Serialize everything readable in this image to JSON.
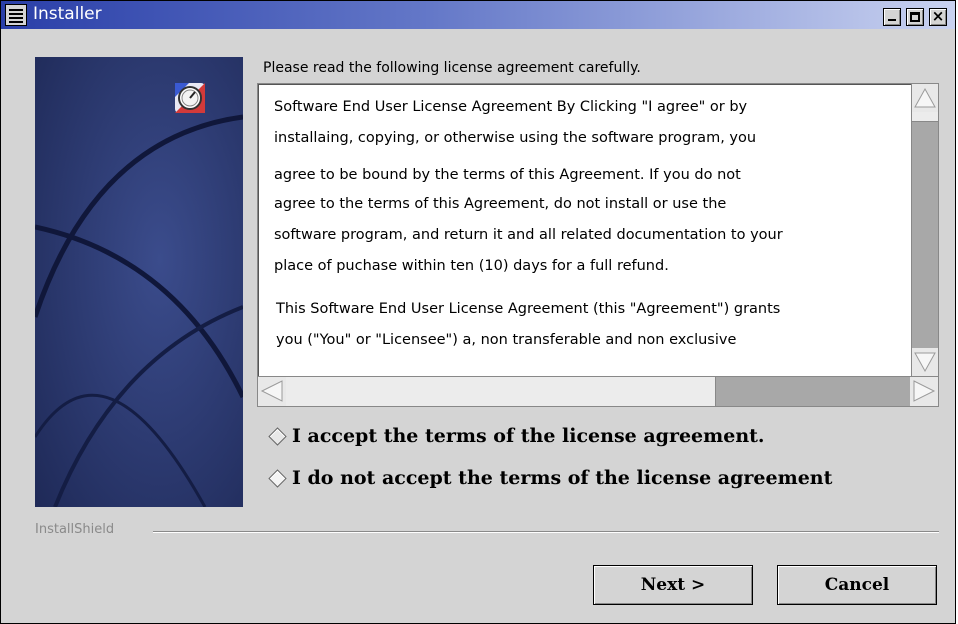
{
  "window": {
    "title": "Installer",
    "controls": {
      "minimize": "minimize-icon",
      "maximize": "maximize-icon",
      "close": "close-icon"
    }
  },
  "instructions": "Please read the following license agreement carefully.",
  "license": {
    "lines": [
      "Software End User License Agreement By Clicking \"I agree\" or by",
      "installaing, copying, or otherwise using the software program, you",
      "agree to be bound by the terms of this Agreement. If you do not",
      "agree to the terms of this Agreement, do not install or use the",
      "software program, and return it and all related documentation to your",
      "place of puchase within ten (10) days for a full refund.",
      "This Software End User License Agreement (this \"Agreement\") grants",
      "you (\"You\" or \"Licensee\") a, non transferable and non exclusive"
    ]
  },
  "options": {
    "accept": "I accept the terms of the license agreement.",
    "decline": "I do not accept the terms of the license agreement"
  },
  "brand": "InstallShield",
  "buttons": {
    "next": "Next >",
    "cancel": "Cancel"
  },
  "colors": {
    "titlebar_start": "#2a3fa8",
    "titlebar_end": "#c9d2f0",
    "panel": "#d4d4d4",
    "side_image": "#2d3c74"
  }
}
